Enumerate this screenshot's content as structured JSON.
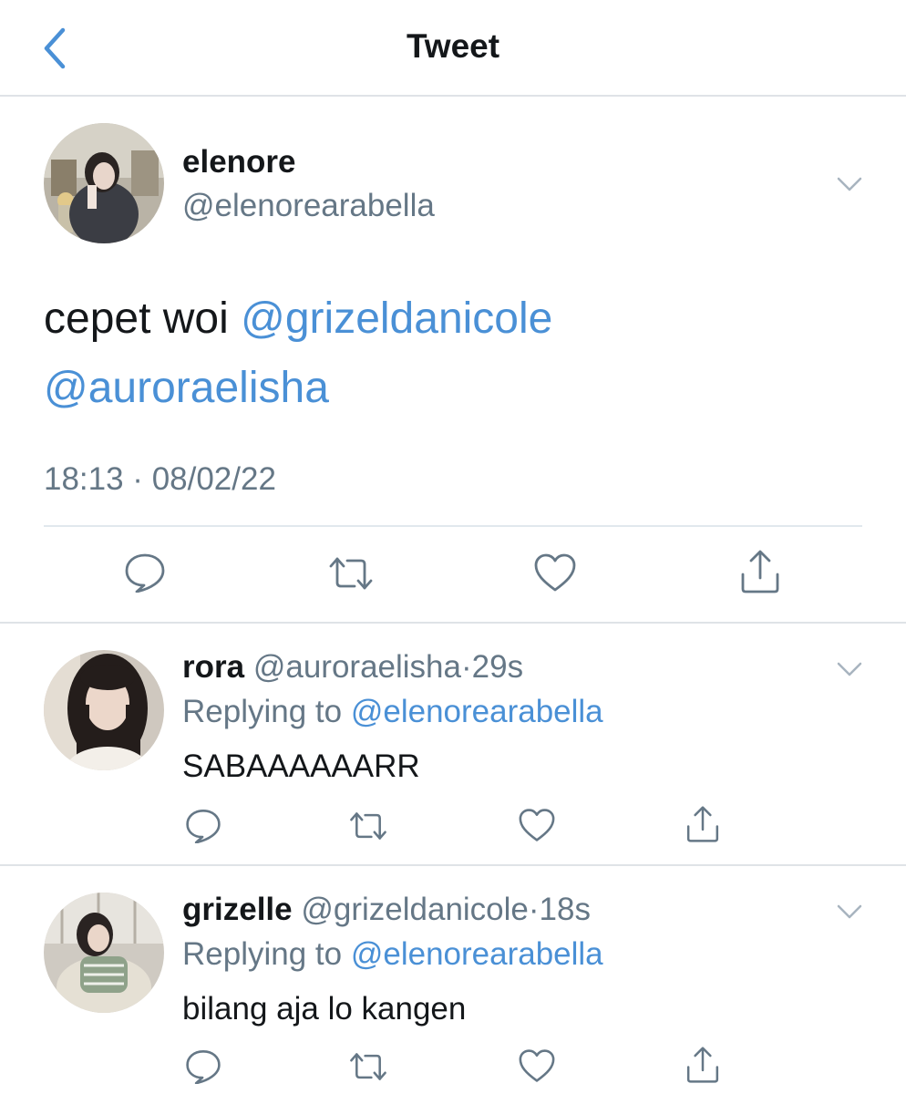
{
  "header": {
    "title": "Tweet",
    "back_icon": "chevron-left-icon"
  },
  "colors": {
    "link": "#4a90d6",
    "secondary_text": "#657786",
    "primary_text": "#14171a",
    "divider": "#dfe3e7"
  },
  "main_tweet": {
    "display_name": "elenore",
    "handle": "@elenorearabella",
    "text_prefix": "cepet woi ",
    "mentions": [
      "@grizeldanicole",
      "@auroraelisha"
    ],
    "timestamp": "18:13 · 08/02/22",
    "actions": [
      "reply-icon",
      "retweet-icon",
      "like-icon",
      "share-icon"
    ]
  },
  "replies": [
    {
      "display_name": "rora",
      "handle": "@auroraelisha",
      "separator": "·",
      "time": "29s",
      "replying_label": "Replying to ",
      "replying_to": "@elenorearabella",
      "text": "SABAAAAAARR"
    },
    {
      "display_name": "grizelle",
      "handle": "@grizeldanicole",
      "separator": "·",
      "time": "18s",
      "replying_label": "Replying to ",
      "replying_to": "@elenorearabella",
      "text": "bilang aja lo kangen"
    }
  ]
}
